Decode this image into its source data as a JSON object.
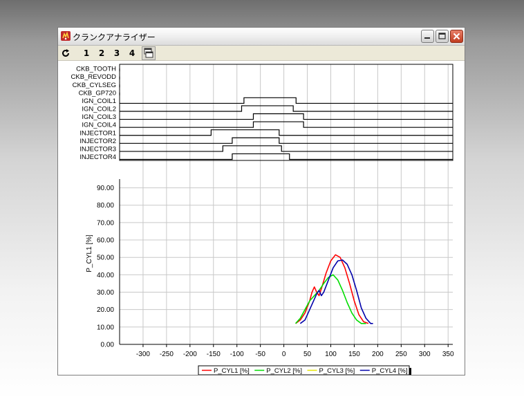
{
  "window": {
    "title": "クランクアナライザー"
  },
  "toolbar": {
    "refresh_icon": "refresh-icon",
    "tabs": [
      "1",
      "2",
      "3",
      "4"
    ],
    "layout_icon": "window-layout-icon"
  },
  "colors": {
    "series": [
      "#ff0000",
      "#00dd00",
      "#e6e600",
      "#0000aa"
    ],
    "grid": "#c8c8c8",
    "signal": "#000000"
  },
  "chart_data": [
    {
      "type": "line",
      "subtype": "timing-diagram",
      "channels": [
        {
          "name": "CKB_TOOTH",
          "segments": []
        },
        {
          "name": "CKB_REVODD",
          "segments": []
        },
        {
          "name": "CKB_CYLSEG",
          "segments": []
        },
        {
          "name": "CKB_GP720",
          "segments": []
        },
        {
          "name": "IGN_COIL1",
          "segments": [
            [
              -85,
              26
            ]
          ]
        },
        {
          "name": "IGN_COIL2",
          "segments": [
            [
              -90,
              20
            ]
          ]
        },
        {
          "name": "IGN_COIL3",
          "segments": [
            [
              -65,
              42
            ]
          ]
        },
        {
          "name": "IGN_COIL4",
          "segments": [
            [
              -65,
              42
            ]
          ]
        },
        {
          "name": "INJECTOR1",
          "segments": [
            [
              -155,
              -10
            ]
          ]
        },
        {
          "name": "INJECTOR2",
          "segments": [
            [
              -110,
              -10
            ]
          ]
        },
        {
          "name": "INJECTOR3",
          "segments": [
            [
              -130,
              -5
            ]
          ]
        },
        {
          "name": "INJECTOR4",
          "segments": [
            [
              -110,
              12
            ]
          ]
        }
      ],
      "xlim": [
        -350,
        360
      ]
    },
    {
      "type": "line",
      "ylabel": "P_CYL1 [%]",
      "xlim": [
        -350,
        360
      ],
      "ylim": [
        0,
        95
      ],
      "xticks": [
        -300,
        -250,
        -200,
        -150,
        -100,
        -50,
        0,
        50,
        100,
        150,
        200,
        250,
        300,
        350
      ],
      "yticks": [
        "0.00",
        "10.00",
        "20.00",
        "30.00",
        "40.00",
        "50.00",
        "60.00",
        "70.00",
        "80.00",
        "90.00"
      ],
      "grid": true,
      "legend_position": "bottom",
      "series": [
        {
          "name": "P_CYL1 [%]",
          "color": "#ff0000",
          "x": [
            25,
            35,
            45,
            55,
            60,
            65,
            70,
            75,
            80,
            90,
            100,
            110,
            120,
            130,
            140,
            150,
            160,
            170,
            180
          ],
          "y": [
            12,
            14,
            18,
            25,
            30,
            33,
            30,
            28,
            32,
            41,
            48,
            51.5,
            50,
            44,
            35,
            25,
            17,
            13,
            12
          ]
        },
        {
          "name": "P_CYL2 [%]",
          "color": "#00dd00",
          "x": [
            25,
            35,
            45,
            55,
            65,
            75,
            85,
            95,
            105,
            115,
            125,
            135,
            145,
            155,
            165,
            175
          ],
          "y": [
            12,
            15,
            20,
            25,
            28,
            31,
            35,
            38.5,
            40,
            37,
            31,
            24,
            18,
            14,
            12,
            12
          ]
        },
        {
          "name": "P_CYL3 [%]",
          "color": "#e6e600",
          "x": [],
          "y": []
        },
        {
          "name": "P_CYL4 [%]",
          "color": "#0000aa",
          "x": [
            35,
            45,
            55,
            65,
            70,
            75,
            80,
            85,
            95,
            105,
            115,
            125,
            135,
            145,
            155,
            165,
            175,
            185,
            190
          ],
          "y": [
            12,
            14,
            20,
            26,
            29,
            31,
            28,
            30,
            37,
            44,
            48,
            48.5,
            46,
            40,
            31,
            21,
            15,
            12,
            12
          ]
        }
      ]
    }
  ]
}
